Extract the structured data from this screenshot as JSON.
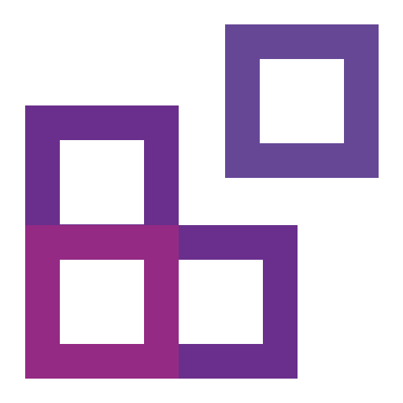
{
  "icon": {
    "name": "apps-add-icon",
    "colors": {
      "purple_light": "#664796",
      "purple_dark": "#6a2f8c",
      "magenta": "#942a84",
      "background": "#ffffff"
    }
  }
}
